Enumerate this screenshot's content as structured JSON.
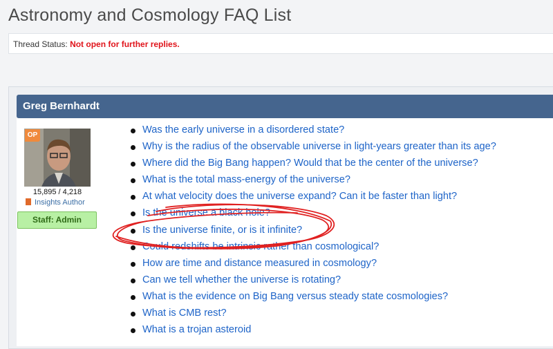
{
  "page": {
    "title": "Astronomy and Cosmology FAQ List"
  },
  "thread_status": {
    "label": "Thread Status:",
    "value": "Not open for further replies."
  },
  "post": {
    "author": "Greg Bernhardt",
    "op_badge": "OP",
    "stats": "15,895 / 4,218",
    "role": "Insights Author",
    "staff_badge": "Staff: Admin",
    "faq_items": [
      {
        "label": "Was the early universe in a disordered state?"
      },
      {
        "label": "Why is the radius of the observable universe in light-years greater than its age?"
      },
      {
        "label": "Where did the Big Bang happen? Would that be the center of the universe?"
      },
      {
        "label": "What is the total mass-energy of the universe?"
      },
      {
        "label": "At what velocity does the universe expand? Can it be faster than light?"
      },
      {
        "label": "Is the universe a black hole?"
      },
      {
        "label": "Is the universe finite, or is it infinite?"
      },
      {
        "label": "Could redshifts be intrinsic rather than cosmological?"
      },
      {
        "label": "How are time and distance measured in cosmology?"
      },
      {
        "label": "Can we tell whether the universe is rotating?"
      },
      {
        "label": "What is the evidence on Big Bang versus steady state cosmologies?"
      },
      {
        "label": "What is CMB rest?"
      },
      {
        "label": "What is a trojan asteroid"
      }
    ]
  },
  "colors": {
    "header_bg": "#45658e",
    "link": "#1e64c8",
    "status_red": "#e0141b",
    "annotation_red": "#e02020"
  },
  "icons": [
    "document-icon",
    "bullet-icon"
  ]
}
